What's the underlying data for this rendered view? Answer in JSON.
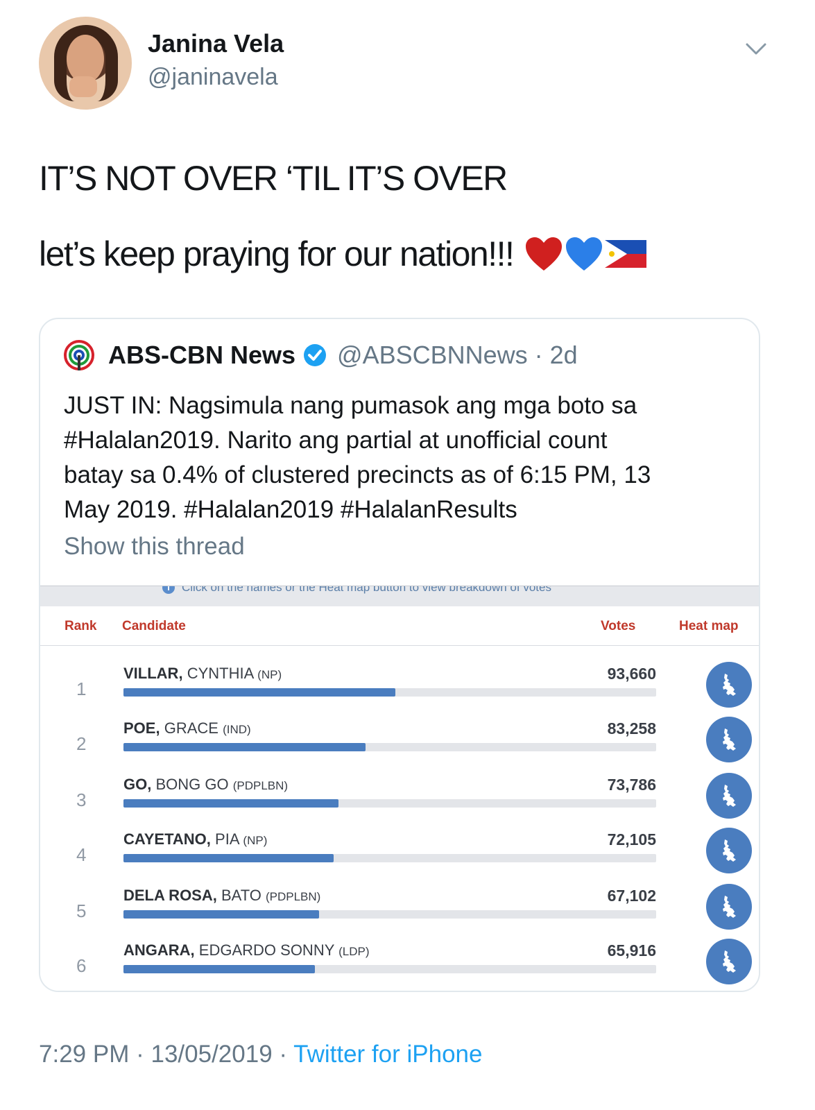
{
  "author": {
    "name": "Janina Vela",
    "handle": "@janinavela"
  },
  "tweet": {
    "line1": "IT’S NOT OVER ‘TIL IT’S OVER",
    "line2": "let’s keep praying for our nation!!!",
    "emojis": [
      "red-heart-emoji",
      "blue-heart-emoji",
      "philippines-flag-emoji"
    ]
  },
  "quoted": {
    "name": "ABS-CBN News",
    "handle": "@ABSCBNNews",
    "separator": "·",
    "age": "2d",
    "body_lines": [
      "JUST IN: Nagsimula nang pumasok ang mga boto sa",
      "#Halalan2019. Narito ang partial at unofficial count",
      "batay sa 0.4% of clustered precincts as of 6:15 PM, 13",
      "May 2019. #Halalan2019 #HalalanResults"
    ],
    "show_thread": "Show this thread"
  },
  "results": {
    "info": "Click on the names or the Heat map button to view breakdown of votes",
    "headers": {
      "rank": "Rank",
      "candidate": "Candidate",
      "votes": "Votes",
      "heatmap": "Heat map"
    },
    "accent_color": "#4a7dbf",
    "header_color": "#c0392b",
    "rows": [
      {
        "rank": "1",
        "last": "VILLAR,",
        "first": "CYNTHIA",
        "party": "(NP)",
        "votes": "93,660",
        "share": 0.51
      },
      {
        "rank": "2",
        "last": "POE,",
        "first": "GRACE",
        "party": "(IND)",
        "votes": "83,258",
        "share": 0.455
      },
      {
        "rank": "3",
        "last": "GO,",
        "first": "BONG GO",
        "party": "(PDPLBN)",
        "votes": "73,786",
        "share": 0.403
      },
      {
        "rank": "4",
        "last": "CAYETANO,",
        "first": "PIA",
        "party": "(NP)",
        "votes": "72,105",
        "share": 0.394
      },
      {
        "rank": "5",
        "last": "DELA ROSA,",
        "first": "BATO",
        "party": "(PDPLBN)",
        "votes": "67,102",
        "share": 0.367
      },
      {
        "rank": "6",
        "last": "ANGARA,",
        "first": "EDGARDO SONNY",
        "party": "(LDP)",
        "votes": "65,916",
        "share": 0.36
      }
    ]
  },
  "footer": {
    "time": "7:29 PM",
    "separator": "·",
    "date": "13/05/2019",
    "source": "Twitter for iPhone"
  }
}
